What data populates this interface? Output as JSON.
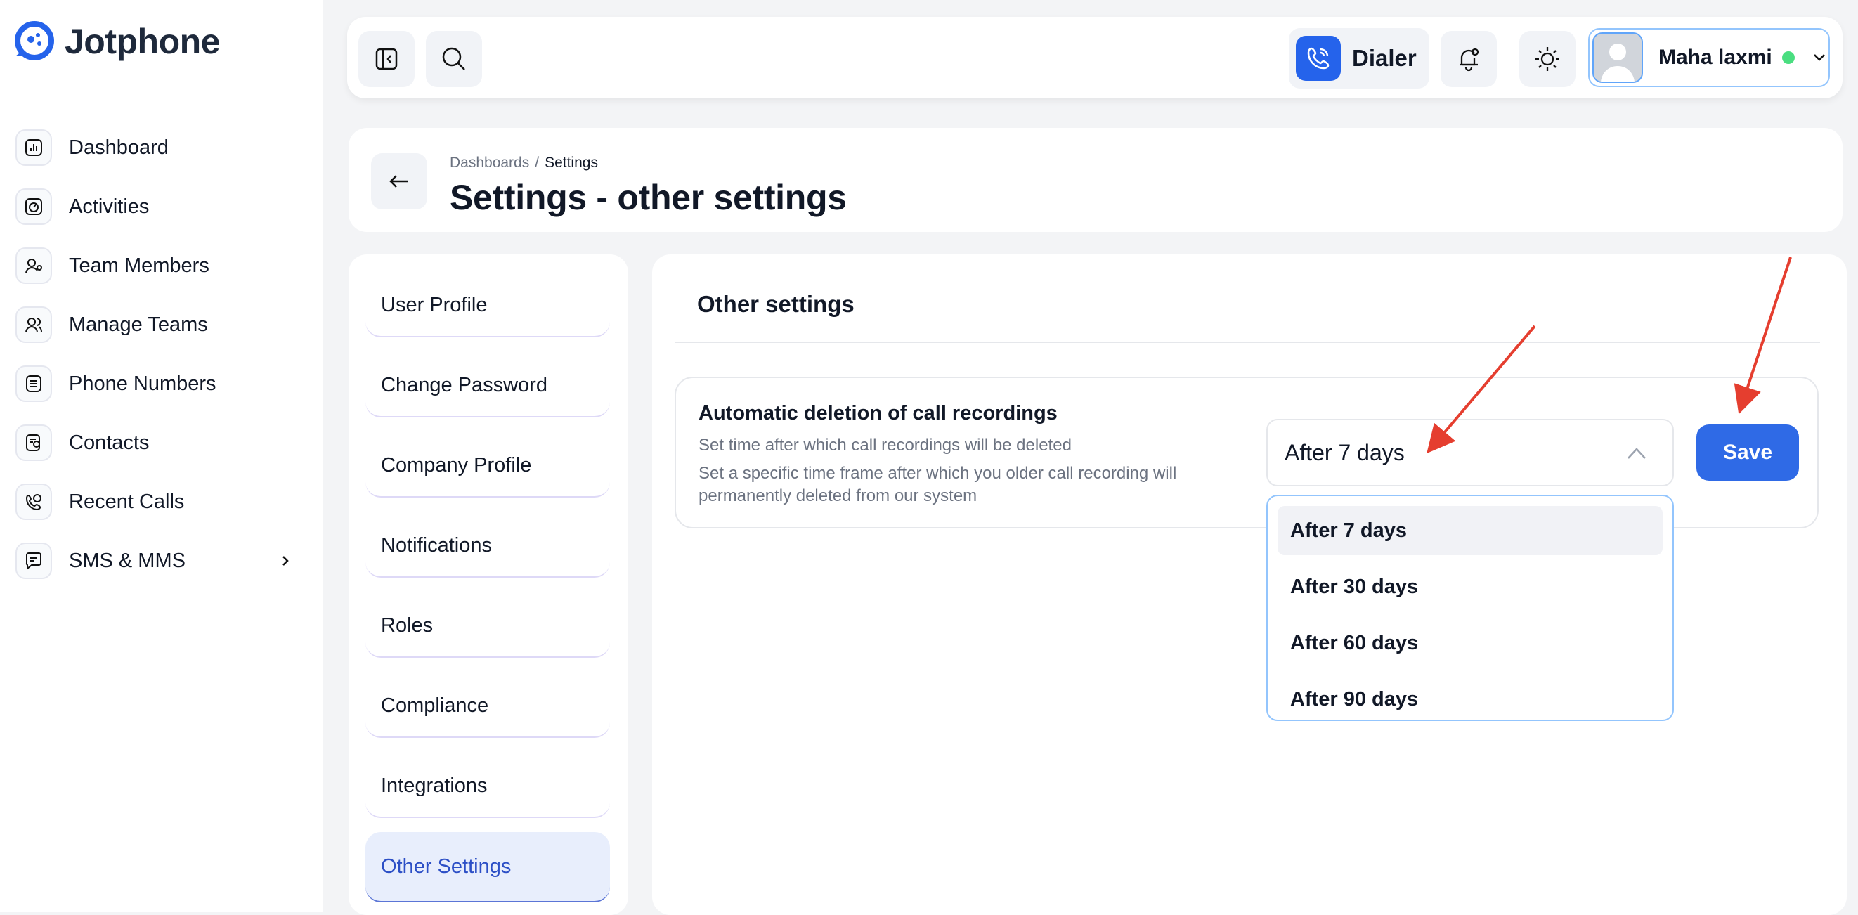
{
  "app": {
    "name": "Jotphone",
    "brand_color": "#2563eb"
  },
  "sidebar": {
    "items": [
      {
        "label": "Dashboard",
        "icon": "chart-icon"
      },
      {
        "label": "Activities",
        "icon": "activity-icon"
      },
      {
        "label": "Team Members",
        "icon": "user-icon"
      },
      {
        "label": "Manage Teams",
        "icon": "users-icon"
      },
      {
        "label": "Phone Numbers",
        "icon": "list-icon"
      },
      {
        "label": "Contacts",
        "icon": "contact-icon"
      },
      {
        "label": "Recent Calls",
        "icon": "phone-clock-icon"
      },
      {
        "label": "SMS & MMS",
        "icon": "message-icon"
      }
    ]
  },
  "topbar": {
    "dialer_label": "Dialer",
    "user_name": "Maha laxmi",
    "status_color": "#4ade80"
  },
  "header": {
    "breadcrumb": [
      "Dashboards",
      "/",
      "Settings"
    ],
    "title": "Settings - other settings"
  },
  "settings_menu": {
    "items": [
      "User Profile",
      "Change Password",
      "Company Profile",
      "Notifications",
      "Roles",
      "Compliance",
      "Integrations",
      "Other Settings"
    ],
    "active": "Other Settings"
  },
  "content": {
    "title": "Other settings",
    "setting": {
      "title": "Automatic deletion of call recordings",
      "subtitle": "Set time after which call recordings will be deleted",
      "description": "Set a specific time frame after which you older call recording will permanently deleted from our system",
      "selected_value": "After 7 days",
      "save_label": "Save"
    },
    "options": [
      "After 7 days",
      "After 30 days",
      "After 60 days",
      "After 90 days"
    ]
  },
  "annotation_color": "#e53e2f"
}
